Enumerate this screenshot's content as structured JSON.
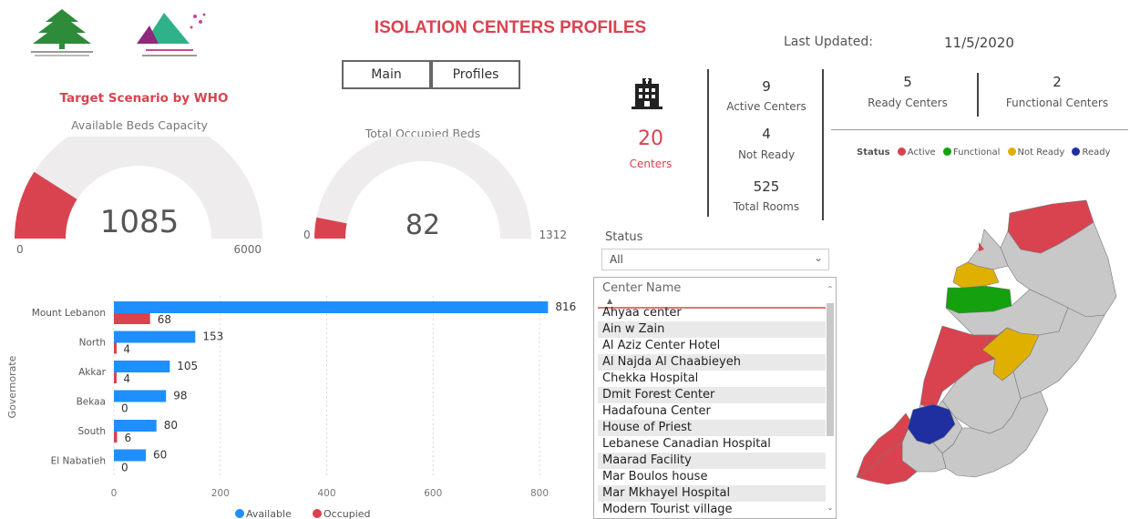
{
  "header": {
    "title": "ISOLATION CENTERS PROFILES",
    "nav": [
      {
        "label": "Main"
      },
      {
        "label": "Profiles"
      }
    ],
    "last_updated_label": "Last Updated:",
    "last_updated_value": "11/5/2020"
  },
  "logos": {
    "left_icon": "cedar-tree-icon",
    "right_icon": "committee-logo-icon"
  },
  "gauges": {
    "section_title": "Target Scenario by WHO",
    "available": {
      "title": "Available Beds Capacity",
      "value": "1085",
      "min": "0",
      "max": "6000",
      "fraction": 0.181
    },
    "occupied": {
      "title": "Total Occupied Beds",
      "value": "82",
      "min": "0",
      "max": "1312",
      "fraction": 0.0625
    }
  },
  "kpis": {
    "building_icon": "building-icon",
    "centers_value": "20",
    "centers_label": "Centers",
    "active_value": "9",
    "active_label": "Active Centers",
    "notready_value": "4",
    "notready_label": "Not Ready",
    "rooms_value": "525",
    "rooms_label": "Total Rooms",
    "ready_value": "5",
    "ready_label": "Ready Centers",
    "functional_value": "2",
    "functional_label": "Functional Centers"
  },
  "status_legend": {
    "title": "Status",
    "items": [
      {
        "label": "Active",
        "color": "#d9434f"
      },
      {
        "label": "Functional",
        "color": "#13a10e"
      },
      {
        "label": "Not Ready",
        "color": "#e0b000"
      },
      {
        "label": "Ready",
        "color": "#1f2f9f"
      }
    ]
  },
  "slicer": {
    "status_label": "Status",
    "status_value": "All",
    "list_header": "Center Name",
    "centers": [
      "Ahyaa center",
      "Ain w Zain",
      "Al Aziz Center Hotel",
      "Al Najda Al Chaabieyeh",
      "Chekka Hospital",
      "Dmit Forest Center",
      "Hadafouna Center",
      "House of Priest",
      "Lebanese Canadian Hospital",
      "Maarad Facility",
      "Mar Boulos house",
      "Mar Mkhayel Hospital",
      "Modern Tourist village"
    ]
  },
  "chart_data": {
    "type": "bar",
    "orientation": "horizontal",
    "ylabel": "Governorate",
    "categories": [
      "Mount Lebanon",
      "North",
      "Akkar",
      "Bekaa",
      "South",
      "El Nabatieh"
    ],
    "series": [
      {
        "name": "Available",
        "color": "#1f8fff",
        "values": [
          816,
          153,
          105,
          98,
          80,
          60
        ]
      },
      {
        "name": "Occupied",
        "color": "#d9434f",
        "values": [
          68,
          4,
          4,
          0,
          6,
          0
        ]
      }
    ],
    "xlim": [
      0,
      850
    ],
    "xticks": [
      "0",
      "200",
      "400",
      "600",
      "800"
    ],
    "grid": true,
    "legend": "bottom"
  },
  "map": {
    "name": "lebanon-status-map"
  }
}
